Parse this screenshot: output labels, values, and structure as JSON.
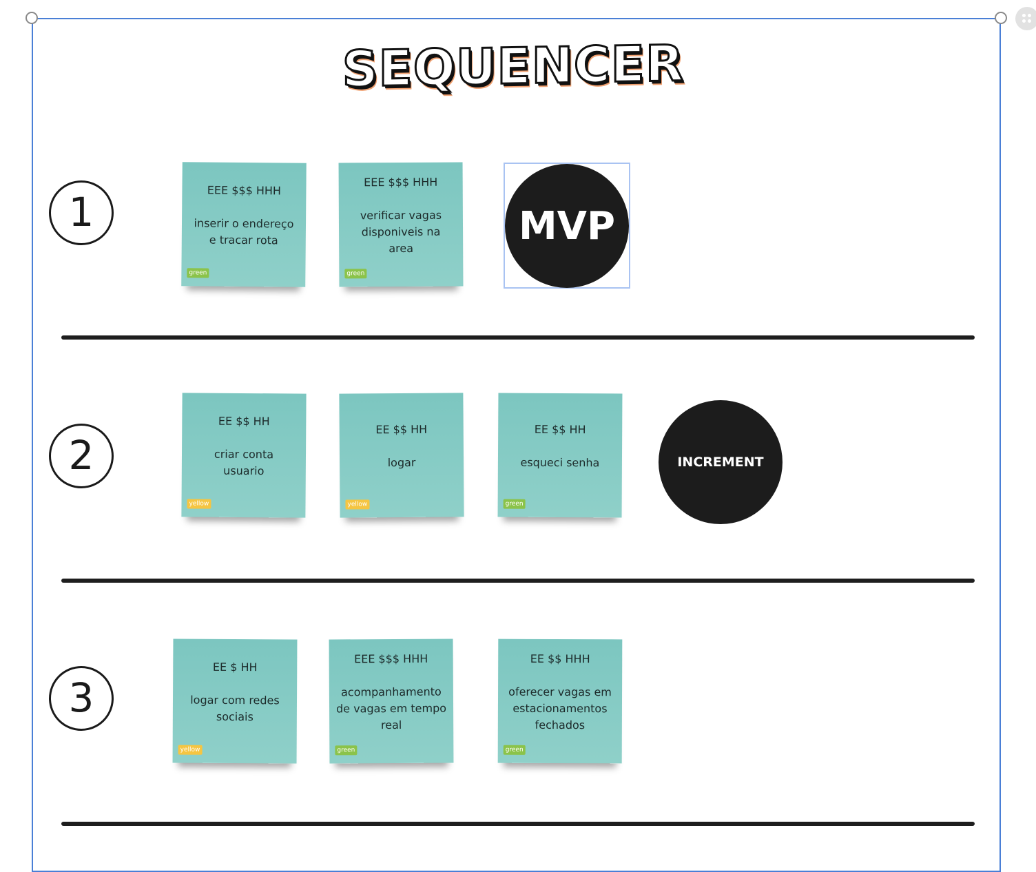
{
  "board": {
    "title": "SEQUENCER"
  },
  "rows": [
    {
      "number": "1",
      "stickies": [
        {
          "line1": "EEE $$$ HHH",
          "line2": "inserir o endereço e tracar rota",
          "tag": "green"
        },
        {
          "line1": "EEE $$$ HHH",
          "line2": "verificar vagas disponiveis na area",
          "tag": "green"
        }
      ],
      "circle": "MVP"
    },
    {
      "number": "2",
      "stickies": [
        {
          "line1": "EE $$ HH",
          "line2": "criar conta usuario",
          "tag": "yellow"
        },
        {
          "line1": "EE $$ HH",
          "line2": "logar",
          "tag": "yellow"
        },
        {
          "line1": "EE $$ HH",
          "line2": "esqueci senha",
          "tag": "green"
        }
      ],
      "circle": "INCREMENT"
    },
    {
      "number": "3",
      "stickies": [
        {
          "line1": "EE $ HH",
          "line2": "logar com redes sociais",
          "tag": "yellow"
        },
        {
          "line1": "EEE $$$ HHH",
          "line2": "acompanhamento de vagas em tempo real",
          "tag": "green"
        },
        {
          "line1": "EE $$ HHH",
          "line2": "oferecer vagas em estacionamentos fechados",
          "tag": "green"
        }
      ]
    }
  ],
  "colors": {
    "sticky": "#7cc6c0",
    "tag_green": "#8bc34a",
    "tag_yellow": "#f5c542",
    "circle": "#1c1c1c",
    "selection": "#4a7fd6"
  },
  "icons": [
    "resize-handle-icon",
    "drag-grip-icon"
  ]
}
